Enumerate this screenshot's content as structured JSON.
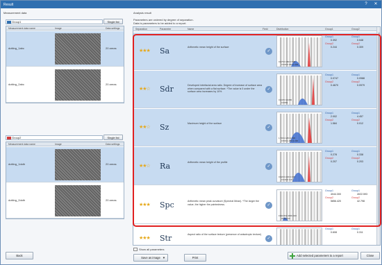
{
  "window": {
    "title": "Result",
    "help_glyph": "?",
    "close_glyph": "✕"
  },
  "left": {
    "header_label": "Measurement data",
    "group1": {
      "name": "Group1",
      "swatch_color": "#2f6fb0",
      "single_btn": "Single list",
      "columns": [
        "Measurement data name",
        "Image",
        "Data settings"
      ],
      "rows": [
        {
          "name": "dotting_1abc",
          "count": "20 areas",
          "selected": true
        },
        {
          "name": "dotting_2abc",
          "count": "20 areas",
          "selected": false
        }
      ]
    },
    "group2": {
      "name": "Group2",
      "swatch_color": "#d23b3b",
      "single_btn": "Single list",
      "columns": [
        "Measurement data name",
        "Image",
        "Data settings"
      ],
      "rows": [
        {
          "name": "dotting_1doth",
          "count": "20 areas",
          "selected": true
        },
        {
          "name": "dotting_2doth",
          "count": "20 areas",
          "selected": false
        }
      ]
    },
    "back_btn": "Back"
  },
  "right": {
    "header_label": "Analysis result",
    "info_line1": "Parameters are ordered by degree of separation.",
    "info_line2": "Data is parameters to be added to a report.",
    "columns": [
      "Separation",
      "Parameter",
      "Name",
      "Field",
      "Distribution",
      "Group1",
      "Group2"
    ],
    "params": [
      {
        "stars": "★★★",
        "symbol": "Sa",
        "desc": "Arithmetic mean height of the surface",
        "v1": [
          "Group1",
          "0.392",
          "Group2",
          "0.244"
        ],
        "v2": [
          "Group1",
          "0.548",
          "Group2",
          "0.309"
        ],
        "axis1": "0.076  0.390  0.530",
        "axis2": "0.030  0.183  0.339"
      },
      {
        "stars": "★★☆",
        "symbol": "Sdr",
        "desc": "Developed interfacial area ratio. Degree of increase of surface area when compared with a flat surface. *The value is 0 under the surface area increases by 10%",
        "v1": [
          "Group1",
          "0.0747",
          "Group2",
          "0.4670"
        ],
        "v2": [
          "Group1",
          "0.0988",
          "Group2",
          "0.0979"
        ],
        "axis1": "0.0470     0.0450",
        "axis2": "0.0653"
      },
      {
        "stars": "★★☆",
        "symbol": "Sz",
        "desc": "Maximum height of the surface",
        "v1": [
          "Group1",
          "2.002",
          "Group2",
          "1.584"
        ],
        "v2": [
          "Group1",
          "4.457",
          "Group2",
          "0.012"
        ],
        "axis1": "1.700  2.203  2.500",
        "axis2": "0.500  1.250  2.200"
      },
      {
        "stars": "★★☆",
        "symbol": "Ra",
        "desc": "Arithmetic mean height of the profile",
        "v1": [
          "Group1",
          "0.278",
          "Group2",
          "0.207"
        ],
        "v2": [
          "Group1",
          "0.338",
          "Group2",
          "0.203"
        ],
        "axis1": "0.020  0.160  0.307",
        "axis2": "0.040  0.110"
      },
      {
        "stars": "★★★",
        "symbol": "Spc",
        "desc": "Arithmetic mean peak curvature (Spectral Mean). *The larger the value, the higher the pointedness.",
        "v1": [
          "Group1",
          "4044.300",
          "Group2",
          "5856.420"
        ],
        "v2": [
          "Group1",
          "4022.593",
          "Group2",
          "42.798"
        ],
        "axis1": "1993.563   4900.040",
        "axis2": "2033.540"
      },
      {
        "stars": "★★★",
        "symbol": "Str",
        "desc": "Aspect ratio of the surface texture (presence of anisotropic texture)",
        "v1": [
          "Group1",
          "0.608",
          "",
          " "
        ],
        "v2": [
          "Group1",
          "0.311",
          "",
          " "
        ],
        "axis1": "",
        "axis2": ""
      }
    ],
    "show_all_label": "Show all parameters",
    "save_image_btn": "Save as image",
    "print_btn": "Print",
    "add_btn": "Add selected parameters to a report",
    "close_btn": "Close"
  }
}
